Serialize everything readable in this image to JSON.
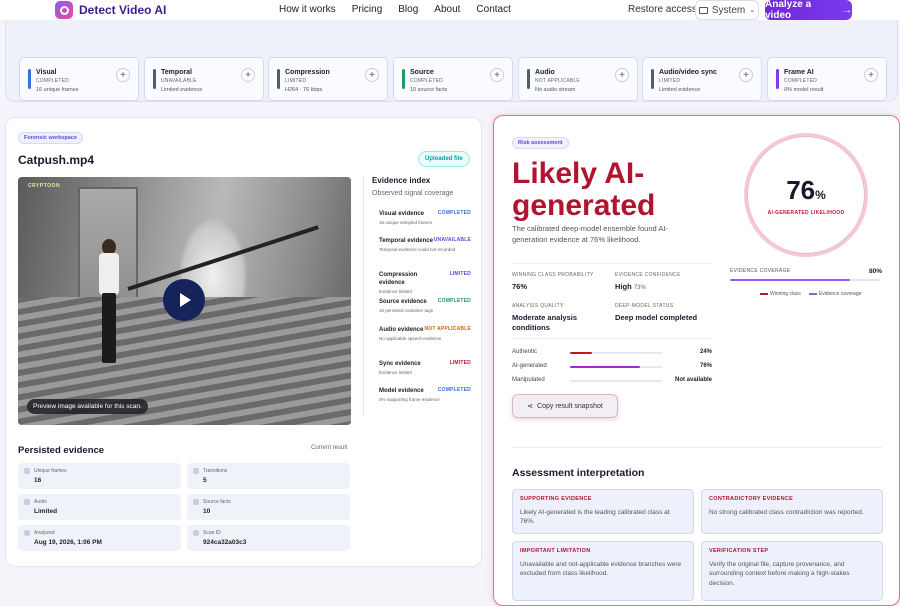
{
  "nav": {
    "brand": "Detect Video AI",
    "links": [
      "How it works",
      "Pricing",
      "Blog",
      "About",
      "Contact"
    ],
    "restore": "Restore access",
    "system": "System",
    "cta": "Analyze a video"
  },
  "engines": [
    {
      "title": "Visual",
      "status": "COMPLETED",
      "detail": "16 unique frames",
      "color": "#3b6fd8"
    },
    {
      "title": "Temporal",
      "status": "UNAVAILABLE",
      "detail": "Limited evidence",
      "color": "#555a6e"
    },
    {
      "title": "Compression",
      "status": "LIMITED",
      "detail": "H264 · 76 kbps",
      "color": "#555a6e"
    },
    {
      "title": "Source",
      "status": "COMPLETED",
      "detail": "10 source facts",
      "color": "#1f9a5b"
    },
    {
      "title": "Audio",
      "status": "NOT APPLICABLE",
      "detail": "No audio stream",
      "color": "#555a6e"
    },
    {
      "title": "Audio/video sync",
      "status": "LIMITED",
      "detail": "Limited evidence",
      "color": "#555a6e"
    },
    {
      "title": "Frame AI",
      "status": "COMPLETED",
      "detail": "0% model result",
      "color": "#7c3aed"
    }
  ],
  "workspace": {
    "tag": "Forensic workspace",
    "file_name": "Catpush.mp4",
    "uploaded": "Uploaded file",
    "preview_note": "Preview image available for this scan.",
    "watermark": "CRYPTOON"
  },
  "evidence_index": {
    "title": "Evidence index",
    "subtitle": "Observed signal coverage",
    "items": [
      {
        "name": "Visual evidence",
        "status": "COMPLETED",
        "detail": "16 unique sampled frames",
        "color": "#3b6fd8"
      },
      {
        "name": "Temporal evidence",
        "status": "UNAVAILABLE",
        "detail": "Temporal evidence could not recorded",
        "color": "#5b4bd6"
      },
      {
        "name": "Compression evidence",
        "status": "LIMITED",
        "detail": "Evidence limited",
        "color": "#5b4bd6"
      },
      {
        "name": "Source evidence",
        "status": "COMPLETED",
        "detail": "10 persisted container tags",
        "color": "#1f9a5b"
      },
      {
        "name": "Audio evidence",
        "status": "NOT APPLICABLE",
        "detail": "No applicable speech evidence",
        "color": "#c26a0a"
      },
      {
        "name": "Sync evidence",
        "status": "LIMITED",
        "detail": "Evidence limited",
        "color": "#c0142f"
      },
      {
        "name": "Model evidence",
        "status": "COMPLETED",
        "detail": "0% supporting frame evidence",
        "color": "#3b6fd8"
      }
    ]
  },
  "persisted": {
    "title": "Persisted evidence",
    "current": "Current result",
    "cells": [
      {
        "label": "Unique frames",
        "value": "16"
      },
      {
        "label": "Transitions",
        "value": "5"
      },
      {
        "label": "Audio",
        "value": "Limited"
      },
      {
        "label": "Source facts",
        "value": "10"
      },
      {
        "label": "Analyzed",
        "value": "Aug 19, 2026, 1:06 PM"
      },
      {
        "label": "Scan ID",
        "value": "924ca32a03c3"
      }
    ]
  },
  "risk": {
    "tag": "Risk assessment",
    "headline": "Likely AI-generated",
    "summary": "The calibrated deep-model ensemble found AI-generation evidence at 76% likelihood.",
    "score": "76",
    "score_unit": "%",
    "score_label": "AI-GENERATED LIKELIHOOD",
    "coverage_label": "EVIDENCE COVERAGE",
    "coverage_value": "80%",
    "coverage_fraction": 0.8,
    "legend": [
      {
        "label": "Winning class",
        "color": "#c0142f"
      },
      {
        "label": "Evidence coverage",
        "color": "#8b5cf6"
      }
    ],
    "winning_label": "WINNING CLASS PROBABILITY",
    "winning_value": "76%",
    "confidence_label": "EVIDENCE CONFIDENCE",
    "confidence_value": "High",
    "confidence_pct": "73%",
    "quality_label": "ANALYSIS QUALITY",
    "quality_value": "Moderate analysis conditions",
    "model_label": "DEEP-MODEL STATUS",
    "model_value": "Deep model completed",
    "probs": [
      {
        "label": "Authentic",
        "value": "24%",
        "fraction": 0.24,
        "color": "#c0142f"
      },
      {
        "label": "AI-generated",
        "value": "76%",
        "fraction": 0.76,
        "color": "#9b2ec4"
      },
      {
        "label": "Manipulated",
        "value": "Not available",
        "fraction": 0,
        "color": "#999"
      }
    ],
    "copy": "Copy result snapshot"
  },
  "interpretation": {
    "title": "Assessment interpretation",
    "cards": [
      {
        "head": "SUPPORTING EVIDENCE",
        "body": "Likely AI-generated is the leading calibrated class at 76%."
      },
      {
        "head": "CONTRADICTORY EVIDENCE",
        "body": "No strong calibrated class contradiction was reported."
      },
      {
        "head": "IMPORTANT LIMITATION",
        "body": "Unavailable and not-applicable evidence branches were excluded from class likelihood."
      },
      {
        "head": "VERIFICATION STEP",
        "body": "Verify the original file, capture provenance, and surrounding context before making a high-stakes decision."
      }
    ]
  }
}
